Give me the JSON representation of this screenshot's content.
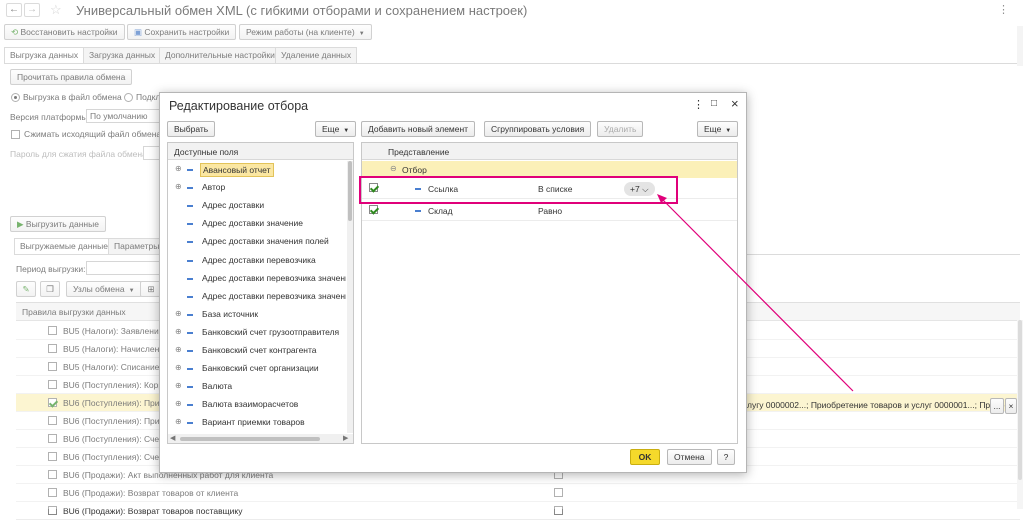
{
  "window": {
    "title": "Универсальный обмен XML (с гибкими отборами и сохранением настроек)"
  },
  "toolbar": {
    "restore": "Восстановить настройки",
    "save": "Сохранить настройки",
    "mode": "Режим работы (на клиенте)"
  },
  "main_tabs": [
    "Выгрузка данных",
    "Загрузка данных",
    "Дополнительные настройки",
    "Удаление данных"
  ],
  "export_panel": {
    "read_rules": "Прочитать правила обмена",
    "radio_file": "Выгрузка в файл обмена",
    "radio_conn": "Подкл",
    "platform_label": "Версия платформы:",
    "platform_value": "По умолчанию",
    "compress_label": "Сжимать исходящий файл обмена д",
    "password_label": "Пароль для сжатия файла обмена:",
    "run_export": "Выгрузить данные",
    "sub_tab_1": "Выгружаемые данные",
    "sub_tab_2": "Параметры",
    "period_label": "Период выгрузки:",
    "nodes_button": "Узлы обмена",
    "rules_header": "Правила выгрузки данных",
    "rules": [
      {
        "label": "BU5 (Налоги): Заявление",
        "checked": false
      },
      {
        "label": "BU5 (Налоги): Начислен",
        "checked": false
      },
      {
        "label": "BU5 (Налоги): Списание Н",
        "checked": false
      },
      {
        "label": "BU6 (Поступления): Корре",
        "checked": false
      },
      {
        "label": "BU6 (Поступления): Приоб",
        "checked": true
      },
      {
        "label": "BU6 (Поступления): Приоб",
        "checked": false
      },
      {
        "label": "BU6 (Поступления): Счет-",
        "checked": false
      },
      {
        "label": "BU6 (Поступления): Счет-",
        "checked": false
      },
      {
        "label": "BU6 (Продажи): Акт выполненных работ для клиента",
        "checked": false
      },
      {
        "label": "BU6 (Продажи): Возврат товаров от клиента",
        "checked": false
      },
      {
        "label": "BU6 (Продажи): Возврат товаров поставщику",
        "checked": false
      }
    ],
    "selected_row_text": "лугу 0000002...; Приобретение товаров и услуг 0000001...; Приоб",
    "selected_row_more": "...",
    "selected_row_close": "×"
  },
  "dialog": {
    "title": "Редактирование отбора",
    "choose": "Выбрать",
    "more_left": "Еще",
    "add_condition": "Добавить новый элемент",
    "group_conditions": "Сгруппировать условия",
    "delete": "Удалить",
    "more_right": "Еще",
    "available_fields_header": "Доступные поля",
    "available_fields": [
      {
        "label": "Авансовый отчет",
        "expandable": true,
        "selected": true
      },
      {
        "label": "Автор",
        "expandable": true,
        "selected": false
      },
      {
        "label": "Адрес доставки",
        "expandable": false,
        "selected": false
      },
      {
        "label": "Адрес доставки значение",
        "expandable": false,
        "selected": false
      },
      {
        "label": "Адрес доставки значения полей",
        "expandable": false,
        "selected": false
      },
      {
        "label": "Адрес доставки перевозчика",
        "expandable": false,
        "selected": false
      },
      {
        "label": "Адрес доставки перевозчика значение",
        "expandable": false,
        "selected": false
      },
      {
        "label": "Адрес доставки перевозчика значения",
        "expandable": false,
        "selected": false
      },
      {
        "label": "База источник",
        "expandable": true,
        "selected": false
      },
      {
        "label": "Банковский счет грузоотправителя",
        "expandable": true,
        "selected": false
      },
      {
        "label": "Банковский счет контрагента",
        "expandable": true,
        "selected": false
      },
      {
        "label": "Банковский счет организации",
        "expandable": true,
        "selected": false
      },
      {
        "label": "Валюта",
        "expandable": true,
        "selected": false
      },
      {
        "label": "Валюта взаиморасчетов",
        "expandable": true,
        "selected": false
      },
      {
        "label": "Вариант приемки товаров",
        "expandable": true,
        "selected": false
      }
    ],
    "filter_header": "Представление",
    "filter_root": "Отбор",
    "filter_rows": [
      {
        "field": "Ссылка",
        "condition": "В списке",
        "value": "+7",
        "checked": true,
        "highlighted": true
      },
      {
        "field": "Склад",
        "condition": "Равно",
        "value": "",
        "checked": true,
        "highlighted": false
      }
    ],
    "ok": "OK",
    "cancel": "Отмена",
    "help": "?"
  },
  "colors": {
    "highlight_border": "#e0007a",
    "ok_yellow": "#f5d92b",
    "selected_row": "#fbf0b8",
    "root_row": "#fbf0b8"
  }
}
